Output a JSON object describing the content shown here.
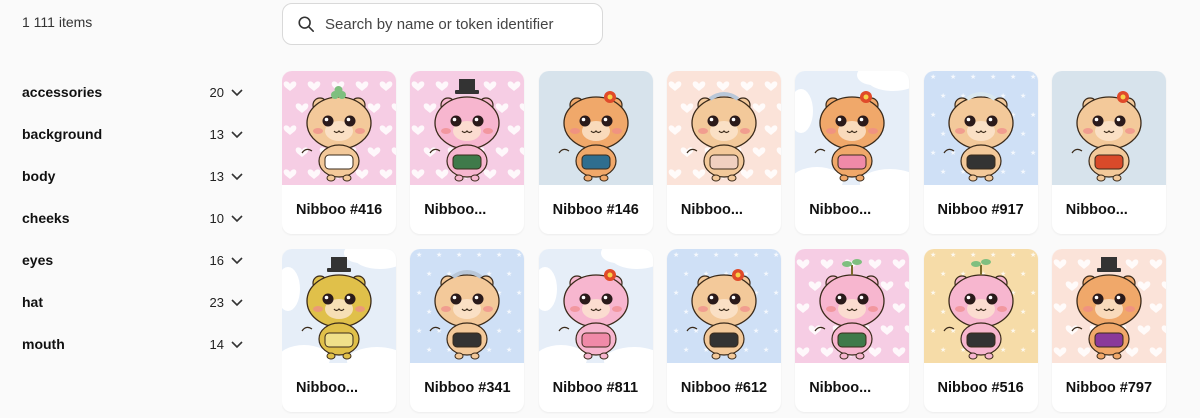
{
  "header": {
    "item_count": "1 111 items"
  },
  "search": {
    "placeholder": "Search by name or token identifier",
    "value": ""
  },
  "filters": [
    {
      "label": "accessories",
      "count": "20"
    },
    {
      "label": "background",
      "count": "13"
    },
    {
      "label": "body",
      "count": "13"
    },
    {
      "label": "cheeks",
      "count": "10"
    },
    {
      "label": "eyes",
      "count": "16"
    },
    {
      "label": "hat",
      "count": "23"
    },
    {
      "label": "mouth",
      "count": "14"
    }
  ],
  "cards": [
    {
      "name": "Nibboo #416",
      "bg": "#f6cde4",
      "pattern": "hearts",
      "body": "#f3c99a",
      "outfit": "#ffffff",
      "accent": "#7fbf7f",
      "hat": "clover"
    },
    {
      "name": "Nibboo...",
      "bg": "#f6cde4",
      "pattern": "hearts",
      "body": "#f7b6cf",
      "outfit": "#3f7a4a",
      "accent": "#333333",
      "hat": "tophat"
    },
    {
      "name": "Nibboo #146",
      "bg": "#d7e3ec",
      "pattern": "none",
      "body": "#f0a86a",
      "outfit": "#2f6e8f",
      "accent": "#e04a2a",
      "hat": "flower"
    },
    {
      "name": "Nibboo...",
      "bg": "#fbe3d9",
      "pattern": "hearts",
      "body": "#f3c99a",
      "outfit": "#f0d0c0",
      "accent": "#b9c7d8",
      "hat": "tiara"
    },
    {
      "name": "Nibboo...",
      "bg": "#e6eef8",
      "pattern": "clouds",
      "body": "#f0a86a",
      "outfit": "#f08aa8",
      "accent": "#e04a2a",
      "hat": "flower"
    },
    {
      "name": "Nibboo #917",
      "bg": "#cfe0f6",
      "pattern": "stars",
      "body": "#f3c99a",
      "outfit": "#333333",
      "accent": "#d9e8f0",
      "hat": "tiara"
    },
    {
      "name": "Nibboo...",
      "bg": "#d7e3ec",
      "pattern": "none",
      "body": "#f3c99a",
      "outfit": "#d94a2a",
      "accent": "#e04a2a",
      "hat": "flower"
    },
    {
      "name": "Nibboo...",
      "bg": "#e6eef8",
      "pattern": "clouds",
      "body": "#e0c04a",
      "outfit": "#f0e08a",
      "accent": "#333333",
      "hat": "tophat"
    },
    {
      "name": "Nibboo #341",
      "bg": "#cfe0f6",
      "pattern": "stars",
      "body": "#f3c99a",
      "outfit": "#333333",
      "accent": "#b9c7d8",
      "hat": "tiara"
    },
    {
      "name": "Nibboo #811",
      "bg": "#e6eef8",
      "pattern": "clouds",
      "body": "#f7b6cf",
      "outfit": "#f08aa8",
      "accent": "#e04a2a",
      "hat": "flower"
    },
    {
      "name": "Nibboo #612",
      "bg": "#cfe0f6",
      "pattern": "stars",
      "body": "#f3c99a",
      "outfit": "#333333",
      "accent": "#e04a2a",
      "hat": "flower"
    },
    {
      "name": "Nibboo...",
      "bg": "#f6cde4",
      "pattern": "hearts",
      "body": "#f7b6cf",
      "outfit": "#3f7a4a",
      "accent": "#7fbf7f",
      "hat": "sprout"
    },
    {
      "name": "Nibboo #516",
      "bg": "#f6dca8",
      "pattern": "stars",
      "body": "#f7b6cf",
      "outfit": "#333333",
      "accent": "#7fbf7f",
      "hat": "sprout"
    },
    {
      "name": "Nibboo #797",
      "bg": "#fbe3d9",
      "pattern": "hearts",
      "body": "#f0a86a",
      "outfit": "#8a3a9a",
      "accent": "#333333",
      "hat": "tophat"
    }
  ]
}
